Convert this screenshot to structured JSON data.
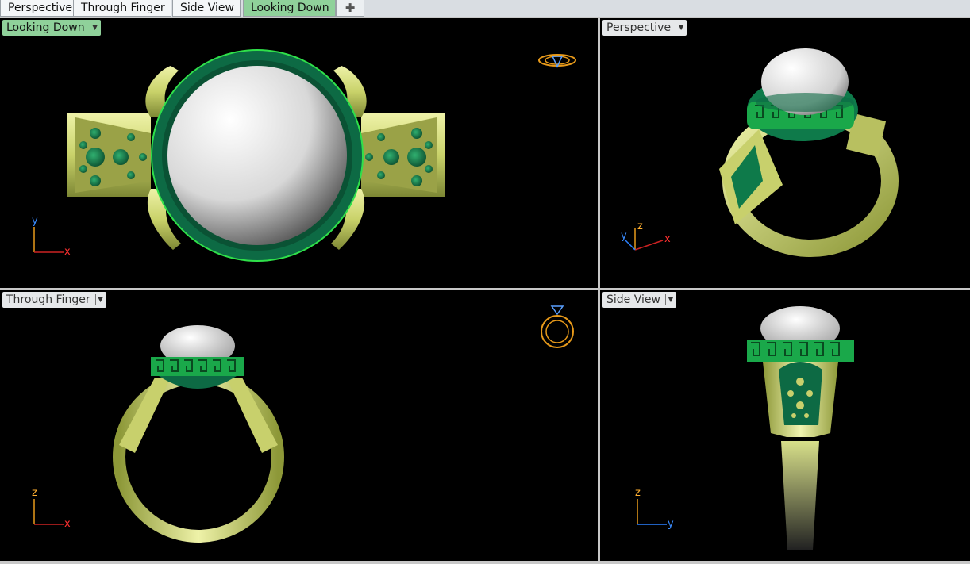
{
  "tabs": [
    {
      "label": "Perspective",
      "active": false
    },
    {
      "label": "Through Finger",
      "active": false
    },
    {
      "label": "Side View",
      "active": false
    },
    {
      "label": "Looking Down",
      "active": true
    }
  ],
  "add_tab_icon": "plus-icon",
  "viewports": {
    "looking_down": {
      "label": "Looking Down",
      "active": true,
      "axis": {
        "v": "y",
        "h": "x"
      }
    },
    "perspective": {
      "label": "Perspective",
      "active": false,
      "axis": {
        "v": "z",
        "a": "y",
        "h": "x"
      }
    },
    "through_finger": {
      "label": "Through Finger",
      "active": false,
      "axis": {
        "v": "z",
        "h": "x"
      }
    },
    "side_view": {
      "label": "Side View",
      "active": false,
      "axis": {
        "v": "z",
        "h": "y"
      }
    }
  },
  "colors": {
    "gold": "#d8e08a",
    "gold_dark": "#8a9440",
    "emerald": "#0e7a4a",
    "emerald_bright": "#21c24a",
    "pearl": "#f2f2f2",
    "active_tab": "#8fd19a",
    "viewport_bg": "#000000",
    "gizmo": "#e89a1a"
  }
}
